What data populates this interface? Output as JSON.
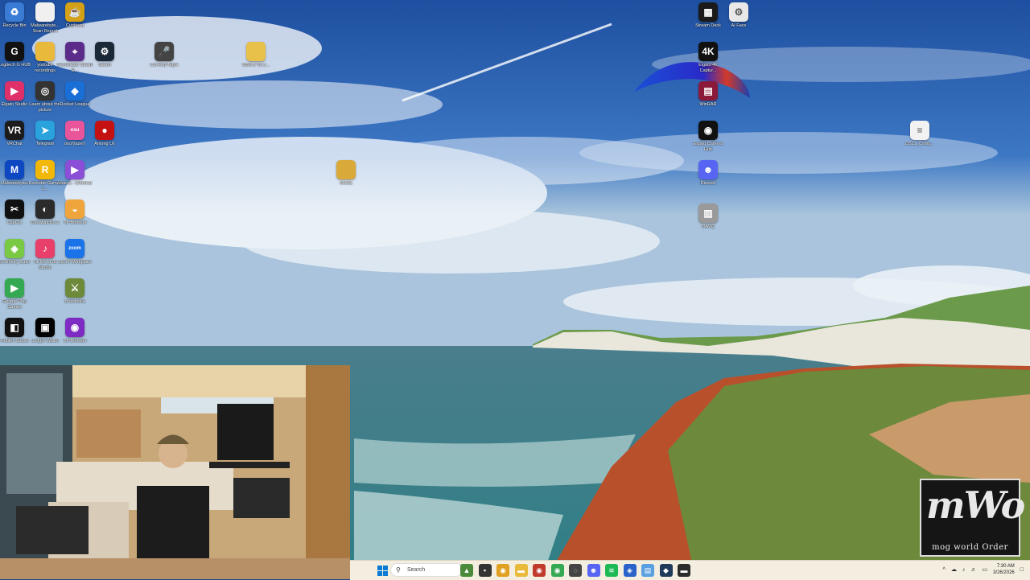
{
  "desktop": {
    "icons": [
      {
        "label": "Recycle Bin",
        "icon": "recycle-bin-icon",
        "glyph": "♻",
        "color": "#3a7bd5"
      },
      {
        "label": "Malwarebyte... Scan Report",
        "icon": "document-icon",
        "glyph": "",
        "color": "#f0f0f0"
      },
      {
        "label": "Cuphead",
        "icon": "cuphead-icon",
        "glyph": "☕",
        "color": "#d4a017"
      },
      {
        "label": "Logitech G HUB",
        "icon": "logitech-g-icon",
        "glyph": "G",
        "color": "#111111"
      },
      {
        "label": "youtube recordings",
        "icon": "folder-icon",
        "glyph": "",
        "color": "#e8b93a"
      },
      {
        "label": "GeoGuessr Steam E...",
        "icon": "geoguessr-icon",
        "glyph": "⌖",
        "color": "#5b2c8a"
      },
      {
        "label": "Steam",
        "icon": "steam-icon",
        "glyph": "⚙",
        "color": "#1b2838"
      },
      {
        "label": "Comedy Night",
        "icon": "microphone-icon",
        "glyph": "🎤",
        "color": "#444444"
      },
      {
        "label": "OBS-2 V2.1...",
        "icon": "folder-icon",
        "glyph": "",
        "color": "#e8c14a"
      },
      {
        "label": "Elgato Studio",
        "icon": "elgato-studio-icon",
        "glyph": "▶",
        "color": "#e0306a"
      },
      {
        "label": "Learn about this picture",
        "icon": "camera-icon",
        "glyph": "◎",
        "color": "#333333"
      },
      {
        "label": "Rocket League",
        "icon": "rocket-league-icon",
        "glyph": "◆",
        "color": "#1a6fd6"
      },
      {
        "label": "VRChat",
        "icon": "vrchat-icon",
        "glyph": "VR",
        "color": "#1c1c1c"
      },
      {
        "label": "Telegram",
        "icon": "telegram-icon",
        "glyph": "➤",
        "color": "#2aa3dd"
      },
      {
        "label": "osu!(lazer)",
        "icon": "osu-icon",
        "glyph": "osu",
        "color": "#e8559a"
      },
      {
        "label": "Among Us",
        "icon": "among-us-icon",
        "glyph": "●",
        "color": "#c51111"
      },
      {
        "label": "Malwarebytes",
        "icon": "malwarebytes-icon",
        "glyph": "M",
        "color": "#0d47c1"
      },
      {
        "label": "Rockstar Games L...",
        "icon": "rockstar-icon",
        "glyph": "R",
        "color": "#f2b807"
      },
      {
        "label": "Videos - Shortcut",
        "icon": "videos-icon",
        "glyph": "▶",
        "color": "#8a4fd6"
      },
      {
        "label": "Media",
        "icon": "folder-icon",
        "glyph": "",
        "color": "#d9a93a"
      },
      {
        "label": "CapCut",
        "icon": "capcut-icon",
        "glyph": "✂",
        "color": "#111111"
      },
      {
        "label": "Overwatch® 2",
        "icon": "overwatch-icon",
        "glyph": "◐",
        "color": "#2b2b2b"
      },
      {
        "label": "Tor Browser",
        "icon": "tor-browser-icon",
        "glyph": "◒",
        "color": "#f0a53c"
      },
      {
        "label": "Geometry Dash",
        "icon": "geometry-dash-icon",
        "glyph": "◈",
        "color": "#7ac943"
      },
      {
        "label": "TikTok LIVE Studio",
        "icon": "tiktok-icon",
        "glyph": "♪",
        "color": "#e8406a"
      },
      {
        "label": "Zoom Workplace",
        "icon": "zoom-icon",
        "glyph": "zoom",
        "color": "#1a73e8"
      },
      {
        "label": "Google Play Games",
        "icon": "google-play-icon",
        "glyph": "▶",
        "color": "#34a853"
      },
      {
        "label": "Brawlhalla",
        "icon": "brawlhalla-icon",
        "glyph": "⚔",
        "color": "#6d8a3a"
      },
      {
        "label": "Roblox Studio",
        "icon": "roblox-icon",
        "glyph": "◧",
        "color": "#111111"
      },
      {
        "label": "Ledger Wallet",
        "icon": "ledger-icon",
        "glyph": "▣",
        "color": "#000000"
      },
      {
        "label": "Tor Browser",
        "icon": "tor-browser-icon",
        "glyph": "◉",
        "color": "#7d2bc2"
      },
      {
        "label": "Stream Deck",
        "icon": "stream-deck-icon",
        "glyph": "▦",
        "color": "#1a1a1a"
      },
      {
        "label": "AI Face",
        "icon": "ai-face-icon",
        "glyph": "⚙",
        "color": "#e8e8e8"
      },
      {
        "label": "Elgato 4K Captur...",
        "icon": "elgato-4k-icon",
        "glyph": "4K",
        "color": "#111111"
      },
      {
        "label": "WinRAR",
        "icon": "winrar-icon",
        "glyph": "▤",
        "color": "#8b1a3a"
      },
      {
        "label": "Elgato Camera Hub",
        "icon": "elgato-camera-icon",
        "glyph": "◉",
        "color": "#111111"
      },
      {
        "label": "Discord",
        "icon": "discord-icon",
        "glyph": "☻",
        "color": "#5865f2"
      },
      {
        "label": "OAVQ",
        "icon": "film-icon",
        "glyph": "▥",
        "color": "#9a9a9a"
      },
      {
        "label": "DS11_Comp...",
        "icon": "text-file-icon",
        "glyph": "≡",
        "color": "#f2f2f2"
      }
    ]
  },
  "taskbar": {
    "search_placeholder": "Search",
    "pinned": [
      {
        "icon": "landscape-thumbnail-icon",
        "glyph": "▲",
        "color": "#4a8a3a"
      },
      {
        "icon": "task-view-icon",
        "glyph": "▪",
        "color": "#333333"
      },
      {
        "icon": "chrome-canary-icon",
        "glyph": "◉",
        "color": "#e0a020"
      },
      {
        "icon": "file-explorer-icon",
        "glyph": "▬",
        "color": "#e8b93a"
      },
      {
        "icon": "media-player-icon",
        "glyph": "◉",
        "color": "#c0392b"
      },
      {
        "icon": "chrome-icon",
        "glyph": "◉",
        "color": "#34a853"
      },
      {
        "icon": "obs-icon",
        "glyph": "◌",
        "color": "#444444"
      },
      {
        "icon": "discord-icon",
        "glyph": "☻",
        "color": "#5865f2"
      },
      {
        "icon": "spotify-icon",
        "glyph": "≋",
        "color": "#1db954"
      },
      {
        "icon": "elgato-icon",
        "glyph": "◈",
        "color": "#2a62c9"
      },
      {
        "icon": "notepad-icon",
        "glyph": "▤",
        "color": "#5aa0e0"
      },
      {
        "icon": "vpn-icon",
        "glyph": "◆",
        "color": "#1f3a5a"
      },
      {
        "icon": "sticky-notes-icon",
        "glyph": "▬",
        "color": "#2b2b2b"
      }
    ],
    "tray": {
      "chevron": "^",
      "time": "7:30 AM",
      "date": "3/26/2026"
    }
  },
  "logo": {
    "big_text": "mWo",
    "small_text": "mog world Order"
  }
}
